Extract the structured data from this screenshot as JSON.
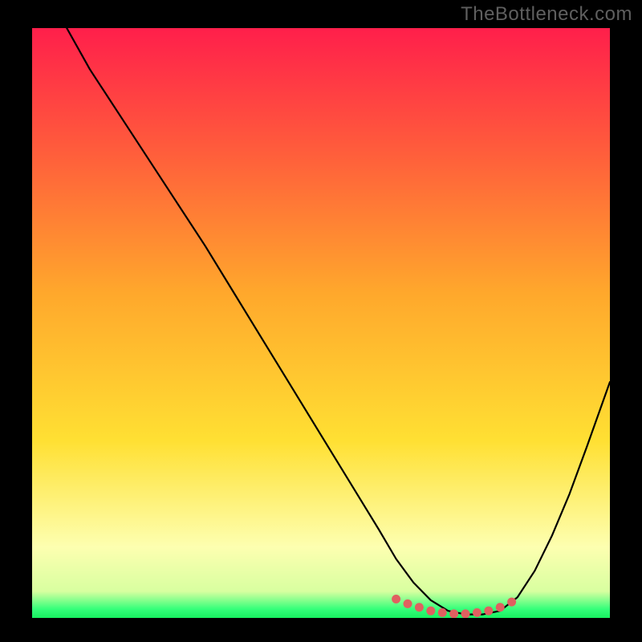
{
  "watermark": "TheBottleneck.com",
  "colors": {
    "frame": "#000000",
    "watermark_text": "#5f5f5f",
    "gradient_top": "#ff1f4b",
    "gradient_upper": "#ff5a3c",
    "gradient_mid": "#ffa82c",
    "gradient_lower": "#ffe033",
    "gradient_pale": "#fdffb0",
    "gradient_green": "#34ff7a",
    "gradient_band_green": "#18f060",
    "curve": "#000000",
    "marker": "#e06060"
  },
  "chart_data": {
    "type": "line",
    "title": "",
    "xlabel": "",
    "ylabel": "",
    "xlim": [
      0,
      100
    ],
    "ylim": [
      0,
      100
    ],
    "grid": false,
    "legend": false,
    "comment": "x and y are in percent of the plot area; y=0 at bottom (best/green), y=100 at top (worst/red). Curve shows bottleneck severity vs configuration; minimum (optimal) region around x≈68–80.",
    "series": [
      {
        "name": "bottleneck-curve",
        "x": [
          6,
          10,
          15,
          20,
          25,
          30,
          35,
          40,
          45,
          50,
          55,
          60,
          63,
          66,
          69,
          72,
          75,
          78,
          81,
          84,
          87,
          90,
          93,
          96,
          100
        ],
        "y": [
          100,
          93,
          85.5,
          78,
          70.5,
          63,
          55,
          47,
          39,
          31,
          23,
          15,
          10,
          6,
          3,
          1.2,
          0.6,
          0.6,
          1.2,
          3.5,
          8,
          14,
          21,
          29,
          40
        ]
      }
    ],
    "markers": {
      "name": "optimal-region-dots",
      "x": [
        63,
        65,
        67,
        69,
        71,
        73,
        75,
        77,
        79,
        81,
        83
      ],
      "y": [
        3.2,
        2.4,
        1.8,
        1.2,
        0.9,
        0.7,
        0.7,
        0.9,
        1.2,
        1.8,
        2.7
      ]
    },
    "gradient_stops": [
      {
        "offset": 0.0,
        "color": "#ff1f4b"
      },
      {
        "offset": 0.2,
        "color": "#ff5a3c"
      },
      {
        "offset": 0.45,
        "color": "#ffa82c"
      },
      {
        "offset": 0.7,
        "color": "#ffe033"
      },
      {
        "offset": 0.88,
        "color": "#fdffb0"
      },
      {
        "offset": 0.955,
        "color": "#d8ffa0"
      },
      {
        "offset": 0.985,
        "color": "#34ff7a"
      },
      {
        "offset": 1.0,
        "color": "#18f060"
      }
    ]
  }
}
